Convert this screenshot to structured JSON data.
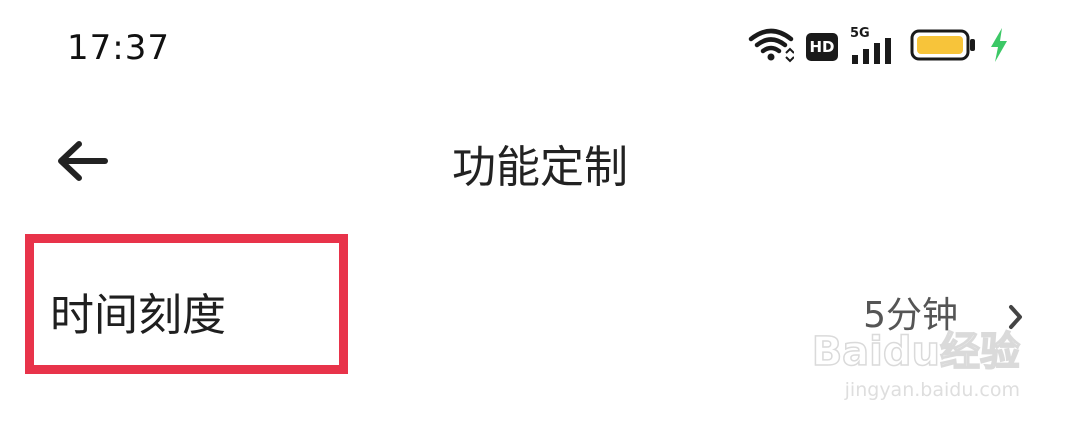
{
  "status_bar": {
    "time": "17:37",
    "network_badge": "HD",
    "signal_type": "5G",
    "icons": [
      "wifi-icon",
      "hd-icon",
      "signal-5g-icon",
      "battery-icon",
      "charging-icon"
    ],
    "battery_color": "#f7c43a",
    "charging_color": "#3cc866"
  },
  "header": {
    "title": "功能定制",
    "back_icon": "back-arrow-icon"
  },
  "setting": {
    "label": "时间刻度",
    "value": "5分钟",
    "chevron_icon": "chevron-right-icon"
  },
  "annotation": {
    "highlight_color": "#e8334a"
  },
  "watermark": {
    "brand": "Baidu经验",
    "site": "jingyan.baidu.com"
  }
}
